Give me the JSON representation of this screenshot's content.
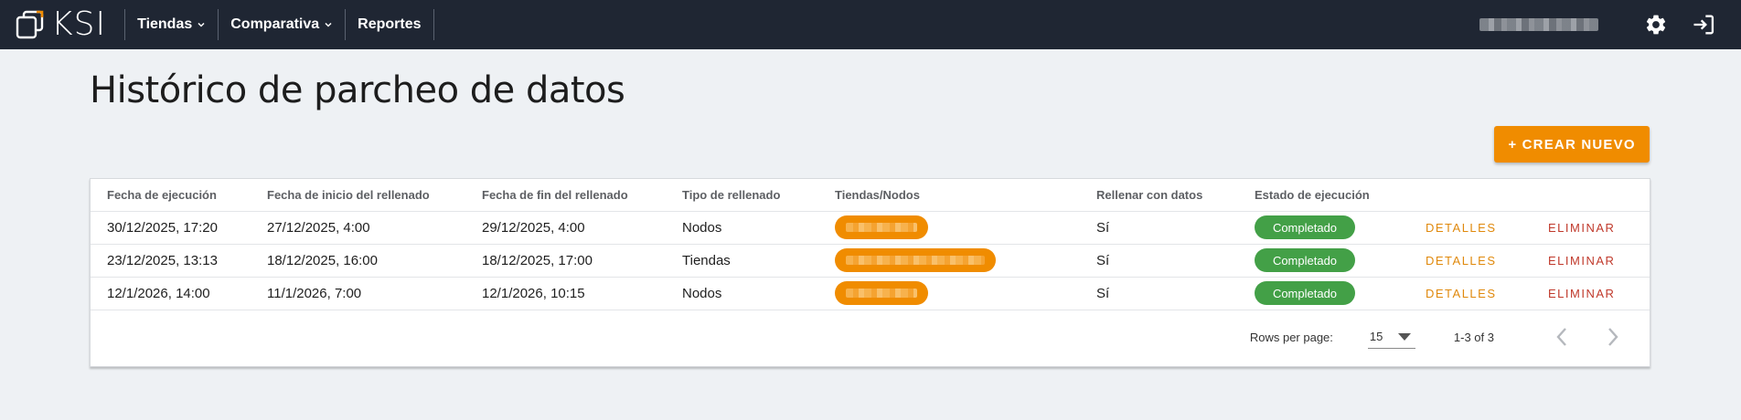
{
  "app": {
    "logo_text": "KSI"
  },
  "nav": {
    "items": [
      {
        "label": "Tiendas",
        "has_dropdown": true
      },
      {
        "label": "Comparativa",
        "has_dropdown": true
      },
      {
        "label": "Reportes",
        "has_dropdown": false
      }
    ]
  },
  "header_right": {
    "user_name_blurred": true,
    "settings_icon": "gear-icon",
    "logout_icon": "logout-icon"
  },
  "page": {
    "title": "Histórico de parcheo de datos",
    "create_label": "+ CREAR NUEVO"
  },
  "table": {
    "columns": [
      "Fecha de ejecución",
      "Fecha de inicio del rellenado",
      "Fecha de fin del rellenado",
      "Tipo de rellenado",
      "Tiendas/Nodos",
      "Rellenar con datos",
      "Estado de ejecución",
      "",
      ""
    ],
    "rows": [
      {
        "ejecucion": "30/12/2025, 17:20",
        "inicio": "27/12/2025, 4:00",
        "fin": "29/12/2025, 4:00",
        "tipo": "Nodos",
        "rellenar": "Sí",
        "estado": "Completado",
        "detalles": "DETALLES",
        "eliminar": "ELIMINAR"
      },
      {
        "ejecucion": "23/12/2025, 13:13",
        "inicio": "18/12/2025, 16:00",
        "fin": "18/12/2025, 17:00",
        "tipo": "Tiendas",
        "rellenar": "Sí",
        "estado": "Completado",
        "detalles": "DETALLES",
        "eliminar": "ELIMINAR"
      },
      {
        "ejecucion": "12/1/2026, 14:00",
        "inicio": "11/1/2026, 7:00",
        "fin": "12/1/2026, 10:15",
        "tipo": "Nodos",
        "rellenar": "Sí",
        "estado": "Completado",
        "detalles": "DETALLES",
        "eliminar": "ELIMINAR"
      }
    ]
  },
  "pagination": {
    "rows_per_page_label": "Rows per page:",
    "rows_per_page_value": "15",
    "range": "1-3 of 3"
  },
  "colors": {
    "navbar": "#1f2633",
    "accent": "#f08c00",
    "success": "#43a047",
    "danger": "#c0392b"
  }
}
